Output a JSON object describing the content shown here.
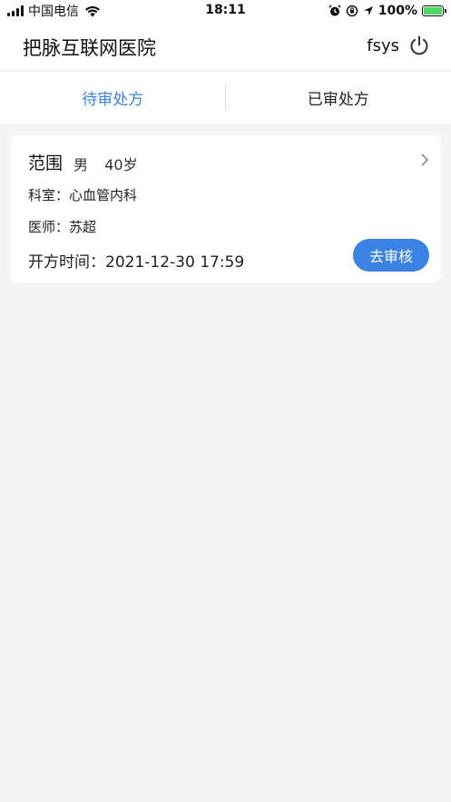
{
  "status_bar": {
    "carrier": "中国电信",
    "time": "18:11",
    "battery": "100%"
  },
  "header": {
    "app_title": "把脉互联网医院",
    "username": "fsys",
    "power_icon": "power-icon"
  },
  "tabs": [
    {
      "label": "待审处方",
      "active": true
    },
    {
      "label": "已审处方",
      "active": false
    }
  ],
  "prescriptions": [
    {
      "patient_name": "范围",
      "gender": "男",
      "age": "40岁",
      "dept_label": "科室：",
      "dept": "心血管内科",
      "doctor_label": "医师：",
      "doctor": "苏超",
      "time_label": "开方时间：",
      "time": "2021-12-30 17:59",
      "action_label": "去审核"
    }
  ],
  "colors": {
    "accent": "#3a82e4",
    "background": "#f5f5f5"
  }
}
